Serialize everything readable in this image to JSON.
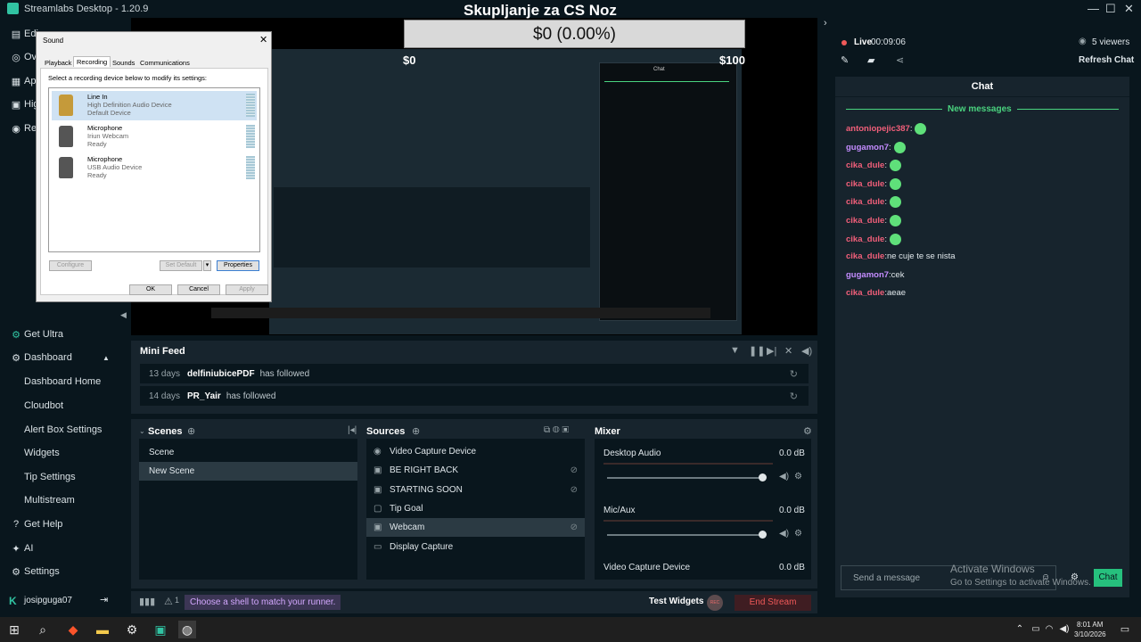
{
  "window": {
    "title": "Streamlabs Desktop - 1.20.9",
    "minimize": "—",
    "maximize": "☐",
    "close": "✕"
  },
  "nav": {
    "items": [
      {
        "icon": "▤",
        "label": "Edi"
      },
      {
        "icon": "◎",
        "label": "Ove"
      },
      {
        "icon": "▦",
        "label": "App"
      },
      {
        "icon": "▣",
        "label": "Hig"
      },
      {
        "icon": "◉",
        "label": "Rec"
      }
    ],
    "get_ultra": "Get Ultra",
    "dashboard": "Dashboard",
    "dashboard_items": [
      "Dashboard Home",
      "Cloudbot",
      "Alert Box Settings",
      "Widgets",
      "Tip Settings",
      "Multistream"
    ],
    "get_help": "Get Help",
    "ai": "AI",
    "settings": "Settings",
    "username": "josipguga07",
    "collapse_glyph": "◀",
    "logout_glyph": "⇥"
  },
  "preview": {
    "stream_title": "Skupljanje za CS Noz",
    "donation_goal": "$0 (0.00%)",
    "inner_amount_left": "$0",
    "inner_amount_right": "$100"
  },
  "sound_dialog": {
    "title": "Sound",
    "tabs": [
      "Playback",
      "Recording",
      "Sounds",
      "Communications"
    ],
    "active_tab": "Recording",
    "instruction": "Select a recording device below to modify its settings:",
    "devices": [
      {
        "name": "Line In",
        "driver": "High Definition Audio Device",
        "status": "Default Device"
      },
      {
        "name": "Microphone",
        "driver": "Iriun Webcam",
        "status": "Ready"
      },
      {
        "name": "Microphone",
        "driver": "USB Audio Device",
        "status": "Ready"
      }
    ],
    "buttons": {
      "configure": "Configure",
      "set_default": "Set Default",
      "properties": "Properties",
      "ok": "OK",
      "cancel": "Cancel",
      "apply": "Apply"
    }
  },
  "mini_feed": {
    "title": "Mini Feed",
    "rows": [
      {
        "days": "13 days",
        "user": "delfiniubicePDF",
        "action": "has followed"
      },
      {
        "days": "14 days",
        "user": "PR_Yair",
        "action": "has followed"
      }
    ]
  },
  "scenes": {
    "title": "Scenes",
    "items": [
      "Scene",
      "New Scene"
    ],
    "active": "New Scene"
  },
  "sources": {
    "title": "Sources",
    "items": [
      {
        "label": "Video Capture Device",
        "hidden": false
      },
      {
        "label": "BE RIGHT BACK",
        "hidden": true
      },
      {
        "label": "STARTING SOON",
        "hidden": true
      },
      {
        "label": "Tip Goal",
        "hidden": false
      },
      {
        "label": "Webcam",
        "hidden": true
      },
      {
        "label": "Display Capture",
        "hidden": false
      }
    ],
    "active": "Webcam"
  },
  "mixer": {
    "title": "Mixer",
    "channels": [
      {
        "name": "Desktop Audio",
        "db": "0.0 dB",
        "level": 1.0
      },
      {
        "name": "Mic/Aux",
        "db": "0.0 dB",
        "level": 1.0
      },
      {
        "name": "Video Capture Device",
        "db": "0.0 dB",
        "level": 1.0
      }
    ]
  },
  "footer": {
    "announcement": "Choose a shell to match your runner.",
    "test_widgets": "Test Widgets",
    "rec_label": "REC",
    "end_stream": "End Stream",
    "alert_count": "1"
  },
  "chat": {
    "live_label": "Live",
    "live_time": "00:09:06",
    "viewers": "5 viewers",
    "refresh": "Refresh Chat",
    "header": "Chat",
    "new_messages": "New messages",
    "messages": [
      {
        "user": "antoniopejic387",
        "text": "",
        "color": "#f25f7a",
        "emote": true
      },
      {
        "user": "gugamon7",
        "text": "",
        "color": "#c48cff",
        "emote": true
      },
      {
        "user": "cika_dule",
        "text": "",
        "color": "#f25f7a",
        "emote": true
      },
      {
        "user": "cika_dule",
        "text": "",
        "color": "#f25f7a",
        "emote": true
      },
      {
        "user": "cika_dule",
        "text": "",
        "color": "#f25f7a",
        "emote": true
      },
      {
        "user": "cika_dule",
        "text": "",
        "color": "#f25f7a",
        "emote": true
      },
      {
        "user": "cika_dule",
        "text": "",
        "color": "#f25f7a",
        "emote": true
      },
      {
        "user": "cika_dule",
        "text": "ne cuje te se nista",
        "color": "#f25f7a",
        "emote": false
      },
      {
        "user": "gugamon7",
        "text": "cek",
        "color": "#c48cff",
        "emote": false
      },
      {
        "user": "cika_dule",
        "text": "aeae",
        "color": "#f25f7a",
        "emote": false
      }
    ],
    "input_placeholder": "Send a message",
    "send": "Chat",
    "activate_title": "Activate Windows",
    "activate_sub": "Go to Settings to activate Windows."
  },
  "taskbar": {
    "time": "8:01 AM",
    "date": "3/10/2026"
  },
  "colors": {
    "accent": "#31c3a2",
    "end_stream": "#f05959",
    "chat_button": "#26c07d"
  }
}
